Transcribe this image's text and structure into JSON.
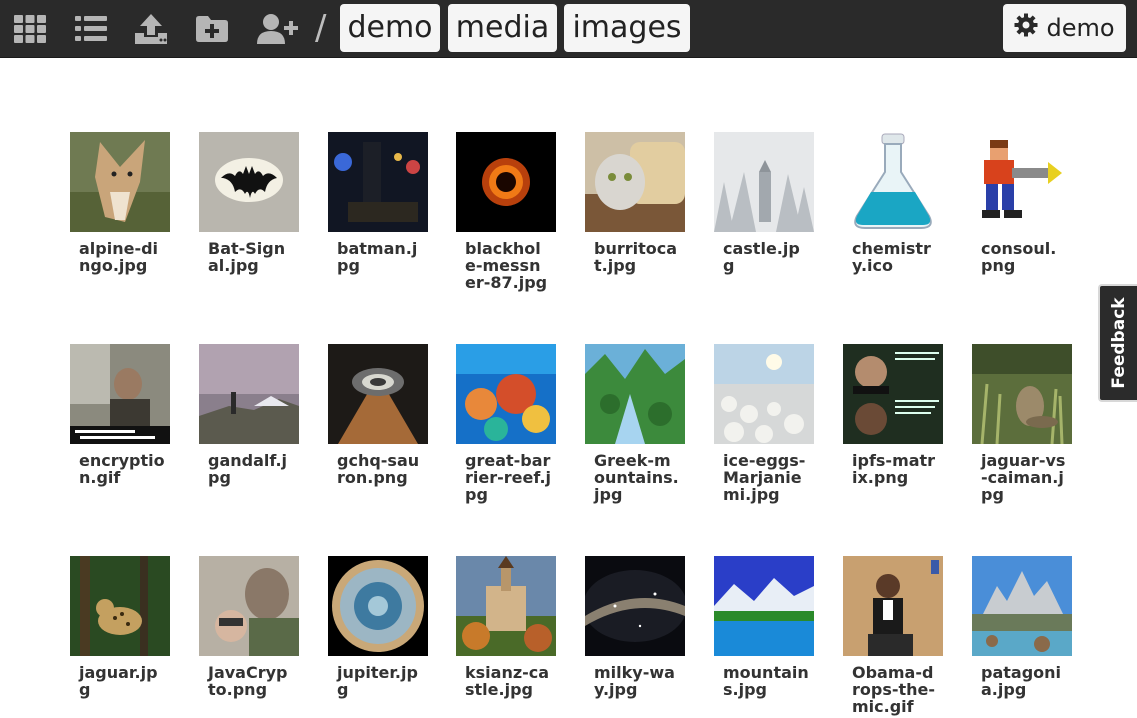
{
  "toolbar": {
    "icons": [
      "grid-view-icon",
      "list-view-icon",
      "upload-icon",
      "new-folder-icon",
      "add-user-icon"
    ],
    "separator": "/",
    "breadcrumb": [
      "demo",
      "media",
      "images"
    ],
    "user_label": "demo",
    "user_icon": "gear-icon"
  },
  "feedback_label": "Feedback",
  "files": [
    {
      "name": "alpine-dingo.jpg"
    },
    {
      "name": "Bat-Signal.jpg"
    },
    {
      "name": "batman.jpg"
    },
    {
      "name": "blackhole-messner-87.jpg"
    },
    {
      "name": "burritocat.jpg"
    },
    {
      "name": "castle.jpg"
    },
    {
      "name": "chemistry.ico"
    },
    {
      "name": "consoul.png"
    },
    {
      "name": "encryption.gif"
    },
    {
      "name": "gandalf.jpg"
    },
    {
      "name": "gchq-sauron.png"
    },
    {
      "name": "great-barrier-reef.jpg"
    },
    {
      "name": "Greek-mountains.jpg"
    },
    {
      "name": "ice-eggs-Marjanie mi.jpg"
    },
    {
      "name": "ipfs-matrix.png"
    },
    {
      "name": "jaguar-vs-caiman.jpg"
    },
    {
      "name": "jaguar.jpg"
    },
    {
      "name": "JavaCrypto.png"
    },
    {
      "name": "jupiter.jpg"
    },
    {
      "name": "ksianz-castle.jpg"
    },
    {
      "name": "milky-way.jpg"
    },
    {
      "name": "mountains.jpg"
    },
    {
      "name": "Obama-drops-the-mic.gif"
    },
    {
      "name": "patagonia.jpg"
    }
  ]
}
